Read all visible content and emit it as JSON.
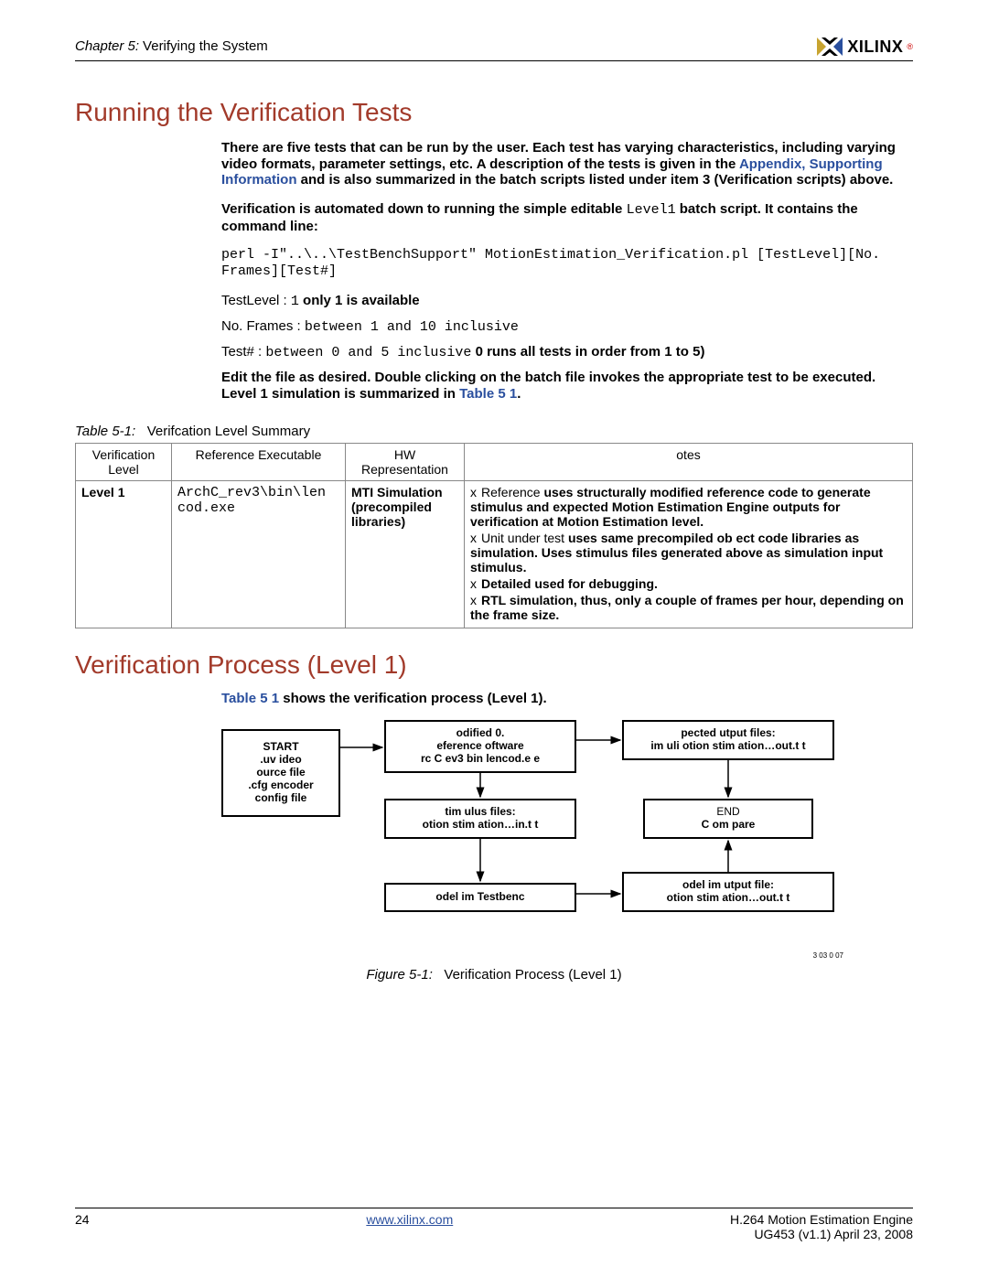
{
  "header": {
    "chapter_prefix": "Chapter 5:",
    "chapter_title": "Verifying the System",
    "logo_text": "XILINX"
  },
  "section1": {
    "title": "Running the Verification Tests",
    "para1_a": "There are five tests that can be run by the user. Each test has varying characteristics, including varying video formats, parameter settings, etc. A description of the tests is given in the ",
    "para1_link": "Appendix,  Supporting Information",
    "para1_b": "  and is also summarized in the batch scripts listed under item 3 (Verification scripts) above.",
    "para2_a": "Verification is automated down to running the simple editable ",
    "para2_code": "Level1",
    "para2_b": " batch script. It contains the command line:",
    "cmd": "perl -I\"..\\..\\TestBenchSupport\" MotionEstimation_Verification.pl [TestLevel][No. Frames][Test#]",
    "p_testlevel_a": "TestLevel  : ",
    "p_testlevel_code": "1",
    "p_testlevel_b": " only 1 is available",
    "p_frames_a": "No. Frames : ",
    "p_frames_code": "between 1 and 10 inclusive",
    "p_test_a": "Test# : ",
    "p_test_code": "between 0 and 5 inclusive",
    "p_test_b": " 0 runs all tests in order from 1 to 5)",
    "para3_a": "Edit the file as desired. Double clicking on the batch file invokes the appropriate test to be executed. Level 1 simulation is summarized in ",
    "para3_link": "Table 5 1",
    "para3_b": "."
  },
  "table": {
    "caption_prefix": "Table 5-1:",
    "caption_text": "Verifcation Level Summary",
    "headers": {
      "c1": "Verification Level",
      "c2": "Reference Executable",
      "c3": "HW Representation",
      "c4": "otes"
    },
    "row": {
      "level": "Level 1",
      "exe": "ArchC_rev3\\bin\\len cod.exe",
      "hw": "MTI Simulation (precompiled libraries)",
      "note1_a": "Reference  ",
      "note1_b": "uses structurally modified reference code to generate stimulus and expected Motion Estimation Engine outputs for verification at Motion Estimation level.",
      "note2_a": "Unit under test   ",
      "note2_b": "uses same precompiled ob ect code libraries as simulation. Uses stimulus files generated above as simulation input stimulus.",
      "note3": "Detailed   used for debugging.",
      "note4": "RTL simulation, thus, only a couple of frames per hour, depending on the frame size."
    }
  },
  "section2": {
    "title": "Verification Process (Level 1)",
    "intro_link": "Table 5 1",
    "intro_rest": " shows the verification process (Level 1)."
  },
  "figure": {
    "box_start_l1": "START",
    "box_start_l2": ".uv  ideo",
    "box_start_l3": "ource file",
    "box_start_l4": ".cfg encoder",
    "box_start_l5": "config file",
    "box_ref_l1": "odified       0.",
    "box_ref_l2": "eference  oftware",
    "box_ref_l3": "rc C    ev3 bin lencod.e e",
    "box_stim_l1": "tim ulus files:",
    "box_stim_l2": "otion stim ation…in.t t",
    "box_tb": "odel im Testbenc",
    "box_exp_l1": "pected  utput files:",
    "box_exp_l2": "im uli  otion stim ation…out.t t",
    "box_end_l1": "END",
    "box_end_l2": "C om pare",
    "box_out_l1": "odel im   utput file:",
    "box_out_l2": "otion stim ation…out.t t",
    "tag": "3 03 0   07",
    "caption_prefix": "Figure 5-1:",
    "caption_text": "Verification Process (Level 1)"
  },
  "footer": {
    "page": "24",
    "url": "www.xilinx.com",
    "doc_title": "H.264 Motion Estimation Engine",
    "doc_id": "UG453 (v1.1) April 23, 2008"
  }
}
